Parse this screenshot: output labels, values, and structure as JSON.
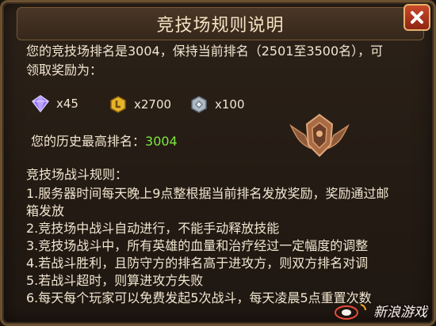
{
  "dialog": {
    "title": "竞技场规则说明",
    "close_label": "✕"
  },
  "ranking": {
    "line1": "您的竞技场排名是3004，保持当前排名（2501至3500名），可",
    "line2": "领取奖励为："
  },
  "rewards": [
    {
      "icon": "diamond-icon",
      "amount": "x45"
    },
    {
      "icon": "gold-coin-icon",
      "amount": "x2700"
    },
    {
      "icon": "silver-coin-icon",
      "amount": "x100"
    }
  ],
  "history": {
    "label": "您的历史最高排名：",
    "value": "3004"
  },
  "rules": {
    "heading": "竞技场战斗规则：",
    "items": [
      "1.服务器时间每天晚上9点整根据当前排名发放奖励，奖励通过邮",
      "箱发放",
      "2.竞技场中战斗自动进行，不能手动释放技能",
      "3.竞技场战斗中，所有英雄的血量和治疗经过一定幅度的调整",
      "4.若战斗胜利，且防守方的排名高于进攻方，则双方排名对调",
      "5.若战斗超时，则算进攻方失败",
      "6.每天每个玩家可以免费发起5次战斗，每天凌晨5点重置次数"
    ]
  },
  "watermark": {
    "logo": "sina",
    "text": "新浪游戏"
  }
}
